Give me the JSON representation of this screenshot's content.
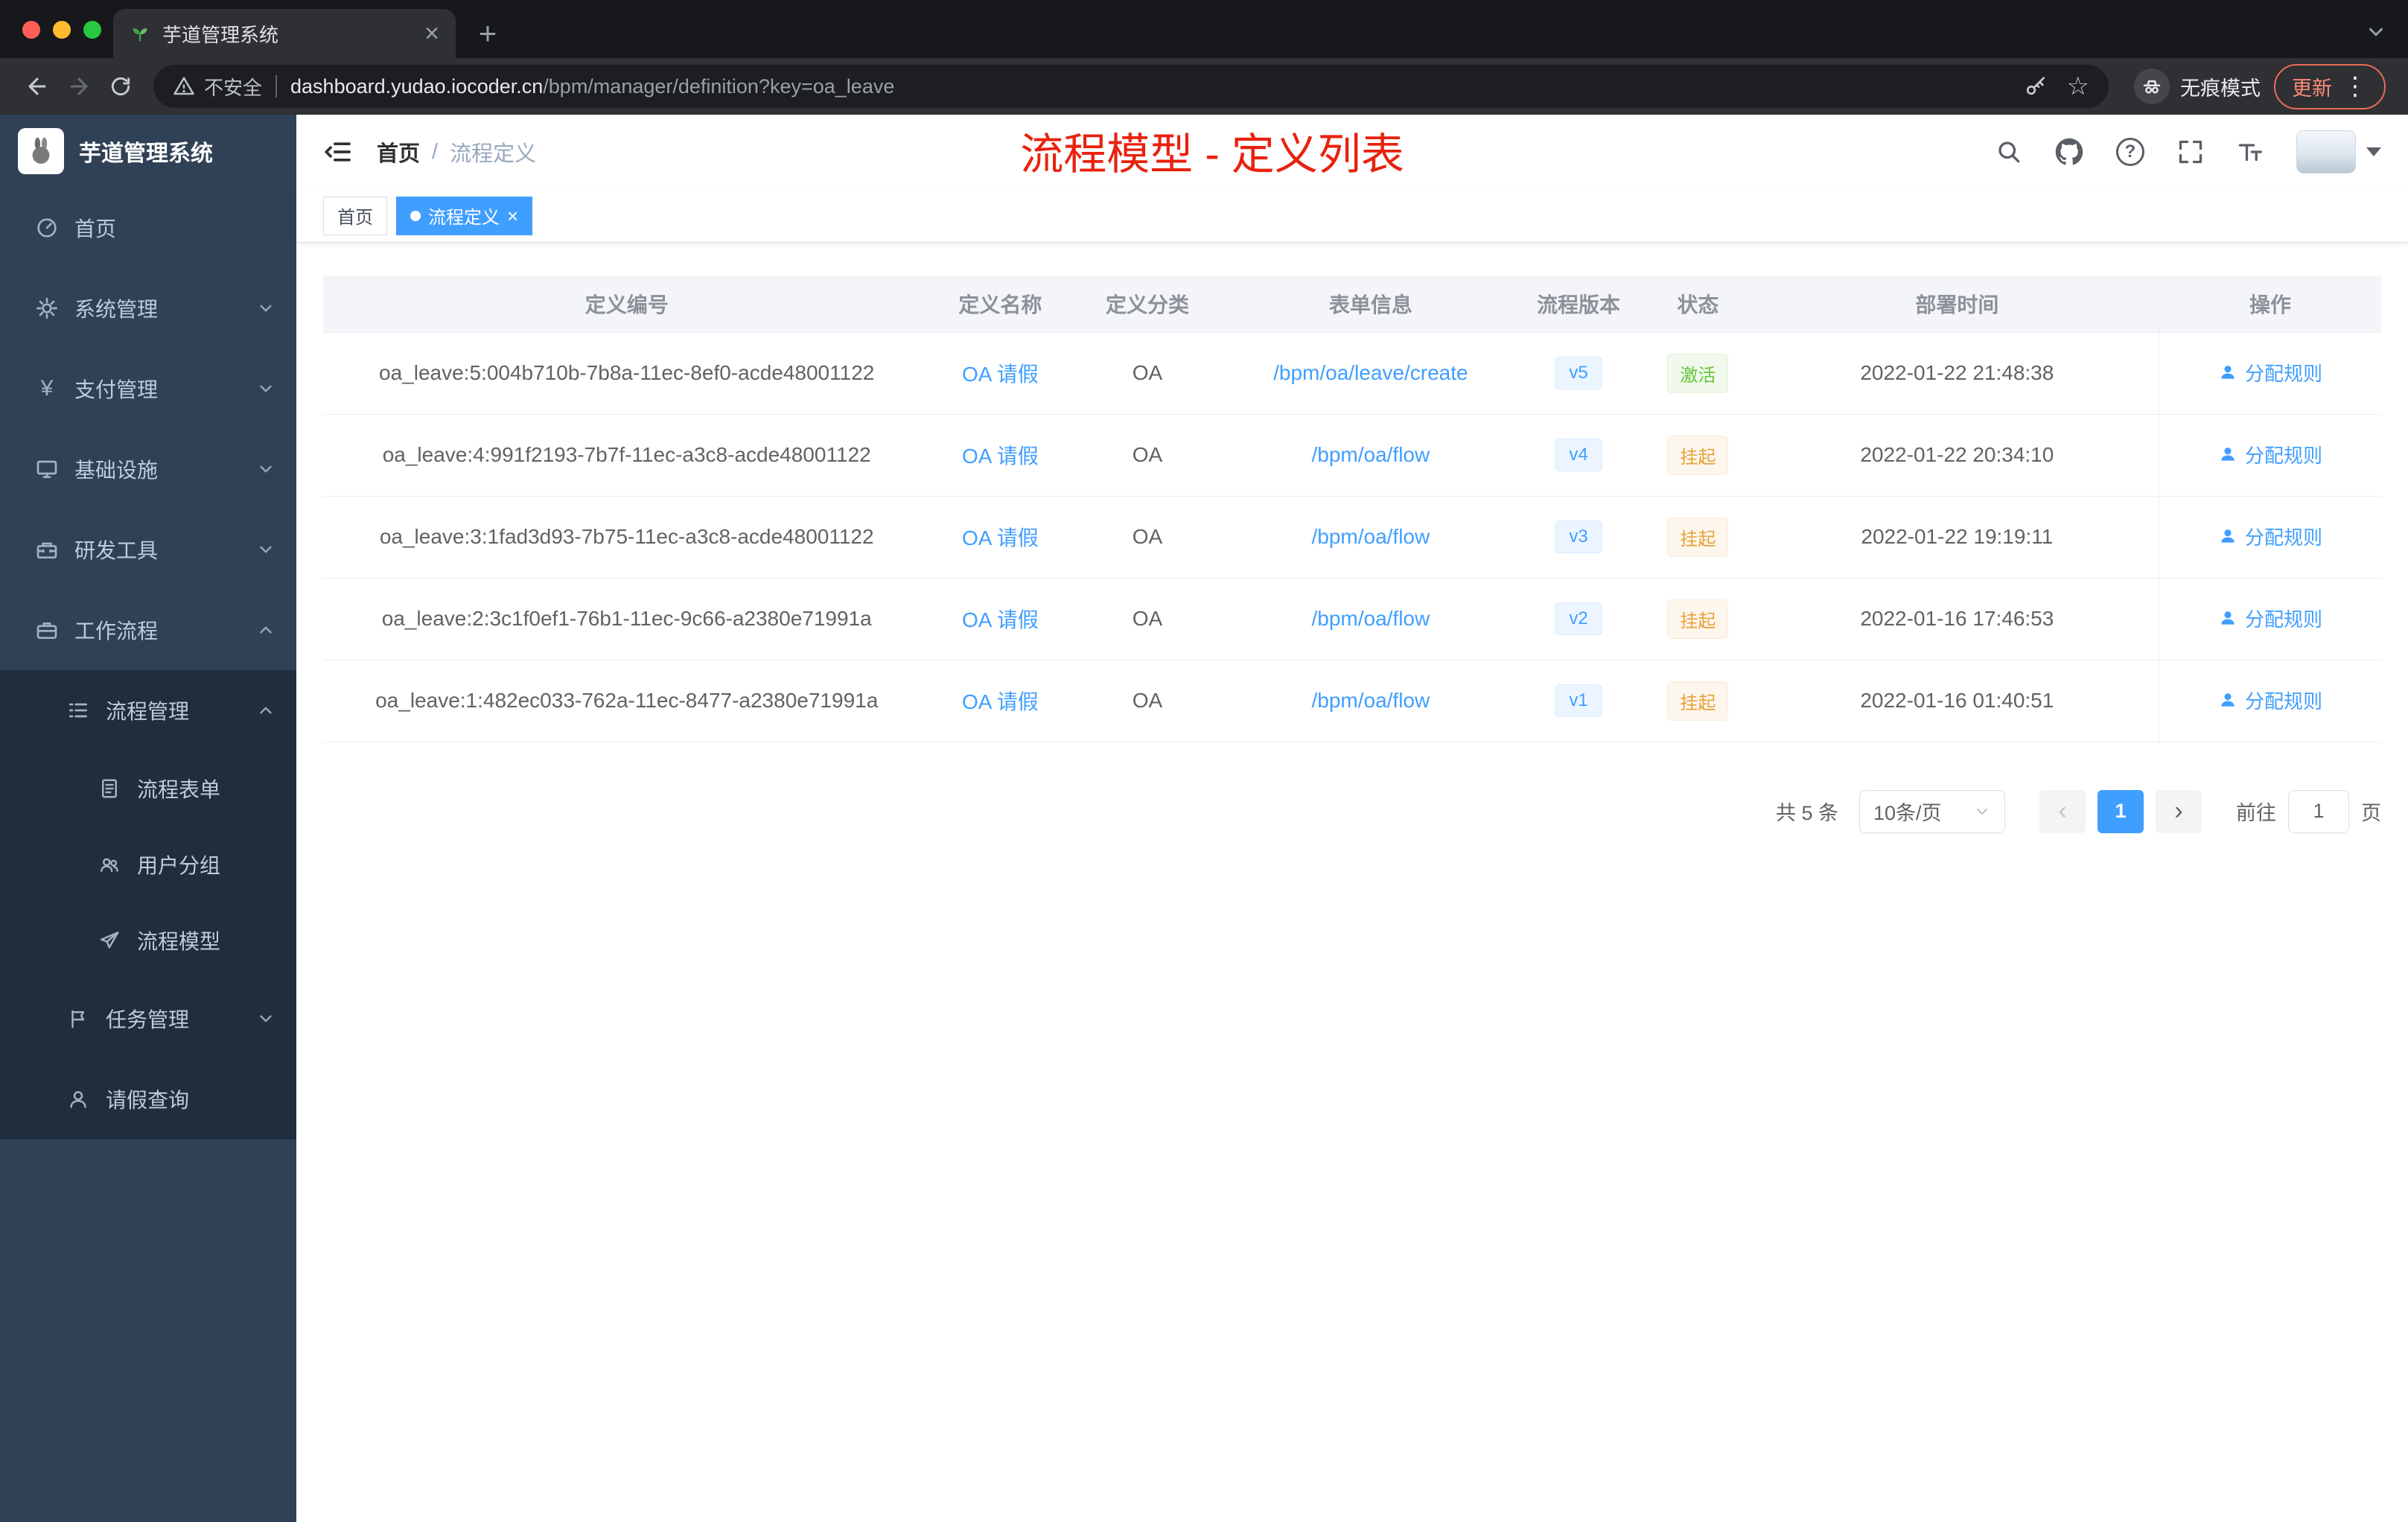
{
  "colors": {
    "primary": "#409eff",
    "success": "#67c23a",
    "warning": "#e6a23c",
    "annotation_red": "#e8220e",
    "sidebar_bg": "#304156",
    "submenu_bg": "#1f2d3d"
  },
  "icons": {
    "close": "×",
    "plus": "+",
    "kebab": "⋮",
    "star": "☆",
    "question": "?",
    "yen": "¥",
    "prev": "‹",
    "next": "›"
  },
  "browser": {
    "tab": {
      "title": "芋道管理系统"
    },
    "address": {
      "security": "不安全",
      "host": "dashboard.yudao.iocoder.cn",
      "path": "/bpm/manager/definition?key=oa_leave"
    },
    "incognito_label": "无痕模式",
    "update_label": "更新"
  },
  "sidebar": {
    "title": "芋道管理系统",
    "items": [
      {
        "label": "首页"
      },
      {
        "label": "系统管理"
      },
      {
        "label": "支付管理"
      },
      {
        "label": "基础设施"
      },
      {
        "label": "研发工具"
      },
      {
        "label": "工作流程"
      },
      {
        "label": "流程管理"
      },
      {
        "label": "流程表单"
      },
      {
        "label": "用户分组"
      },
      {
        "label": "流程模型"
      },
      {
        "label": "任务管理"
      },
      {
        "label": "请假查询"
      }
    ]
  },
  "navbar": {
    "breadcrumb": {
      "home": "首页",
      "sep": "/",
      "current": "流程定义"
    },
    "annotation": "流程模型 - 定义列表"
  },
  "tags": {
    "home": "首页",
    "active": "流程定义"
  },
  "table": {
    "headers": [
      "定义编号",
      "定义名称",
      "定义分类",
      "表单信息",
      "流程版本",
      "状态",
      "部署时间",
      "操作"
    ],
    "action_label": "分配规则",
    "rows": [
      {
        "id": "oa_leave:5:004b710b-7b8a-11ec-8ef0-acde48001122",
        "name": "OA 请假",
        "category": "OA",
        "form": "/bpm/oa/leave/create",
        "version": "v5",
        "status": "激活",
        "status_type": "success",
        "time": "2022-01-22 21:48:38"
      },
      {
        "id": "oa_leave:4:991f2193-7b7f-11ec-a3c8-acde48001122",
        "name": "OA 请假",
        "category": "OA",
        "form": "/bpm/oa/flow",
        "version": "v4",
        "status": "挂起",
        "status_type": "warning",
        "time": "2022-01-22 20:34:10"
      },
      {
        "id": "oa_leave:3:1fad3d93-7b75-11ec-a3c8-acde48001122",
        "name": "OA 请假",
        "category": "OA",
        "form": "/bpm/oa/flow",
        "version": "v3",
        "status": "挂起",
        "status_type": "warning",
        "time": "2022-01-22 19:19:11"
      },
      {
        "id": "oa_leave:2:3c1f0ef1-76b1-11ec-9c66-a2380e71991a",
        "name": "OA 请假",
        "category": "OA",
        "form": "/bpm/oa/flow",
        "version": "v2",
        "status": "挂起",
        "status_type": "warning",
        "time": "2022-01-16 17:46:53"
      },
      {
        "id": "oa_leave:1:482ec033-762a-11ec-8477-a2380e71991a",
        "name": "OA 请假",
        "category": "OA",
        "form": "/bpm/oa/flow",
        "version": "v1",
        "status": "挂起",
        "status_type": "warning",
        "time": "2022-01-16 01:40:51"
      }
    ]
  },
  "pagination": {
    "total": "共 5 条",
    "page_size": "10条/页",
    "page": "1",
    "goto": "前往",
    "goto_value": "1",
    "unit": "页"
  }
}
